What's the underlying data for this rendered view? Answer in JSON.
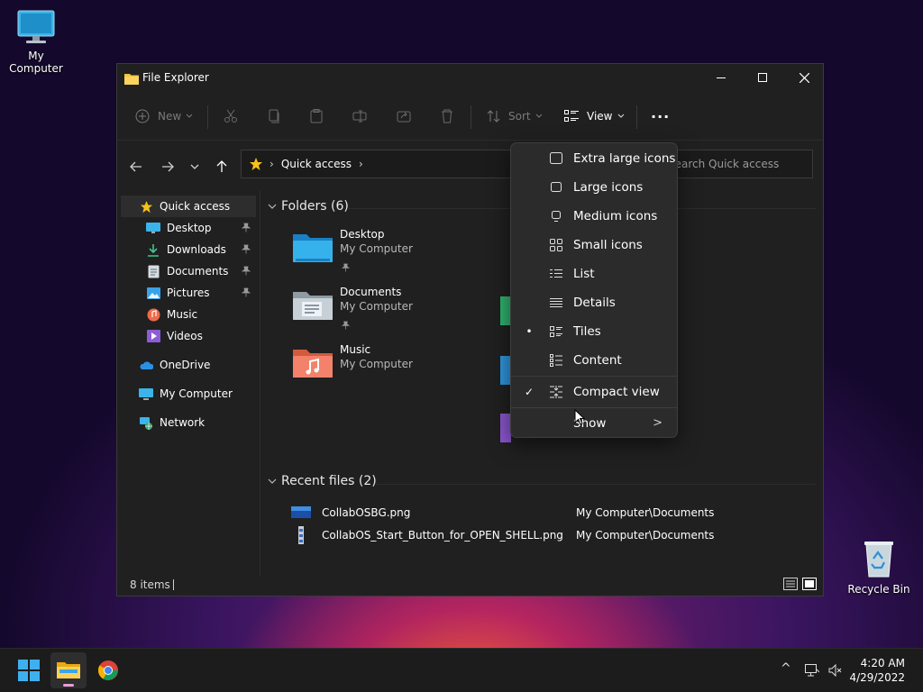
{
  "desktop": {
    "my_computer_label": "My Computer",
    "recycle_bin_label": "Recycle Bin"
  },
  "window": {
    "title": "File Explorer",
    "controls": {
      "minimize": "minimize",
      "maximize": "maximize",
      "close": "close"
    }
  },
  "toolbar": {
    "new_label": "New",
    "sort_label": "Sort",
    "view_label": "View",
    "more_label": "···"
  },
  "address": {
    "crumbs": [
      "Quick access"
    ],
    "search_placeholder": "Search Quick access"
  },
  "sidebar": {
    "items": [
      {
        "label": "Quick access",
        "icon": "star-icon",
        "pinned": false
      },
      {
        "label": "Desktop",
        "icon": "desktop-icon",
        "pinned": true
      },
      {
        "label": "Downloads",
        "icon": "download-icon",
        "pinned": true
      },
      {
        "label": "Documents",
        "icon": "documents-icon",
        "pinned": true
      },
      {
        "label": "Pictures",
        "icon": "pictures-icon",
        "pinned": true
      },
      {
        "label": "Music",
        "icon": "music-icon",
        "pinned": false
      },
      {
        "label": "Videos",
        "icon": "videos-icon",
        "pinned": false
      },
      {
        "label": "OneDrive",
        "icon": "cloud-icon",
        "pinned": false
      },
      {
        "label": "My Computer",
        "icon": "computer-icon",
        "pinned": false
      },
      {
        "label": "Network",
        "icon": "network-icon",
        "pinned": false
      }
    ]
  },
  "folders": {
    "header": "Folders (6)",
    "items": [
      {
        "name": "Desktop",
        "location": "My Computer",
        "pinned": true
      },
      {
        "name": "Documents",
        "location": "My Computer",
        "pinned": true
      },
      {
        "name": "Music",
        "location": "My Computer",
        "pinned": false
      }
    ]
  },
  "recent": {
    "header": "Recent files (2)",
    "items": [
      {
        "name": "CollabOSBG.png",
        "path": "My Computer\\Documents"
      },
      {
        "name": "CollabOS_Start_Button_for_OPEN_SHELL.png",
        "path": "My Computer\\Documents"
      }
    ]
  },
  "status": {
    "items_count": "8 items"
  },
  "view_menu": {
    "items": [
      {
        "label": "Extra large icons",
        "marker": ""
      },
      {
        "label": "Large icons",
        "marker": ""
      },
      {
        "label": "Medium icons",
        "marker": ""
      },
      {
        "label": "Small icons",
        "marker": ""
      },
      {
        "label": "List",
        "marker": ""
      },
      {
        "label": "Details",
        "marker": ""
      },
      {
        "label": "Tiles",
        "marker": "•"
      },
      {
        "label": "Content",
        "marker": ""
      },
      {
        "label": "Compact view",
        "marker": "✓"
      },
      {
        "label": "Show",
        "marker": ""
      }
    ],
    "submenu_arrow": ">"
  },
  "taskbar": {
    "time": "4:20 AM",
    "date": "4/29/2022",
    "tray_chevron": "^"
  },
  "colors": {
    "accent": "#4cc2ff",
    "window_bg": "#202020",
    "menu_bg": "#2b2b2b",
    "folder_blue": "#2d9cdb"
  }
}
